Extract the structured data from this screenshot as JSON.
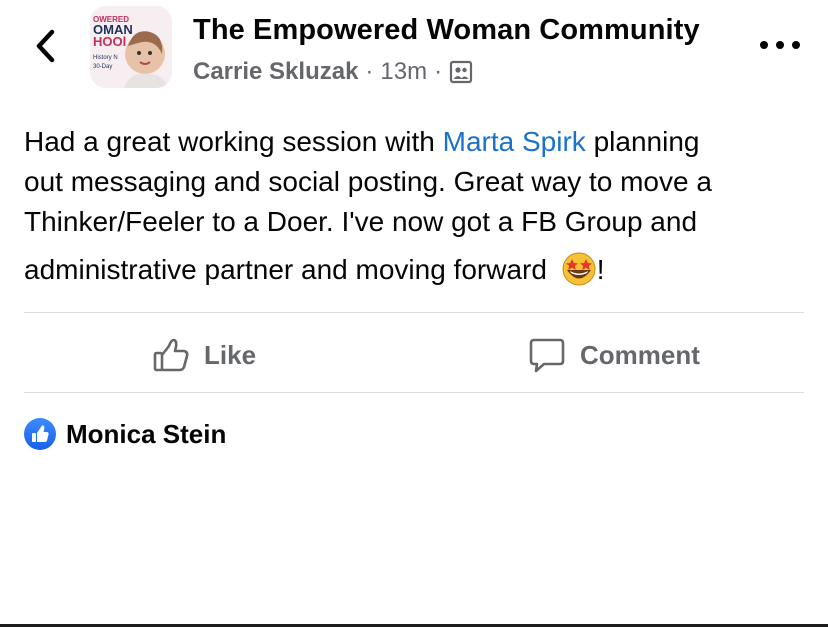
{
  "header": {
    "back_icon": "chevron-left-icon",
    "avatar_text": {
      "line1": "OWERED",
      "line2": "OMAN",
      "line3": "HOOl",
      "line4": "History N",
      "line5": "30-Day"
    },
    "group_name": "The Empowered Woman Community",
    "author": "Carrie Skluzak",
    "separator": "·",
    "time_ago": "13m",
    "audience_icon": "group-icon",
    "more_icon": "more-horizontal-icon"
  },
  "post": {
    "line1_before": "Had a great working session with ",
    "mention": "Marta Spirk",
    "line1_after": " planning",
    "line2": "out messaging and social posting.  Great way to move a",
    "line3": "Thinker/Feeler to a Doer. I've now got a FB Group and",
    "line4_text": "administrative partner and moving forward ",
    "line4_emoji": "star-struck-emoji",
    "line4_end": "!"
  },
  "actions": {
    "like_label": "Like",
    "like_icon": "thumbs-up-outline-icon",
    "comment_label": "Comment",
    "comment_icon": "speech-bubble-icon"
  },
  "reactions": {
    "icon": "like-reaction-icon",
    "name": "Monica Stein"
  },
  "colors": {
    "mention": "#1a73c9",
    "secondary_text": "#65676b",
    "divider": "#dadde1",
    "like_badge": "#1877f2"
  }
}
